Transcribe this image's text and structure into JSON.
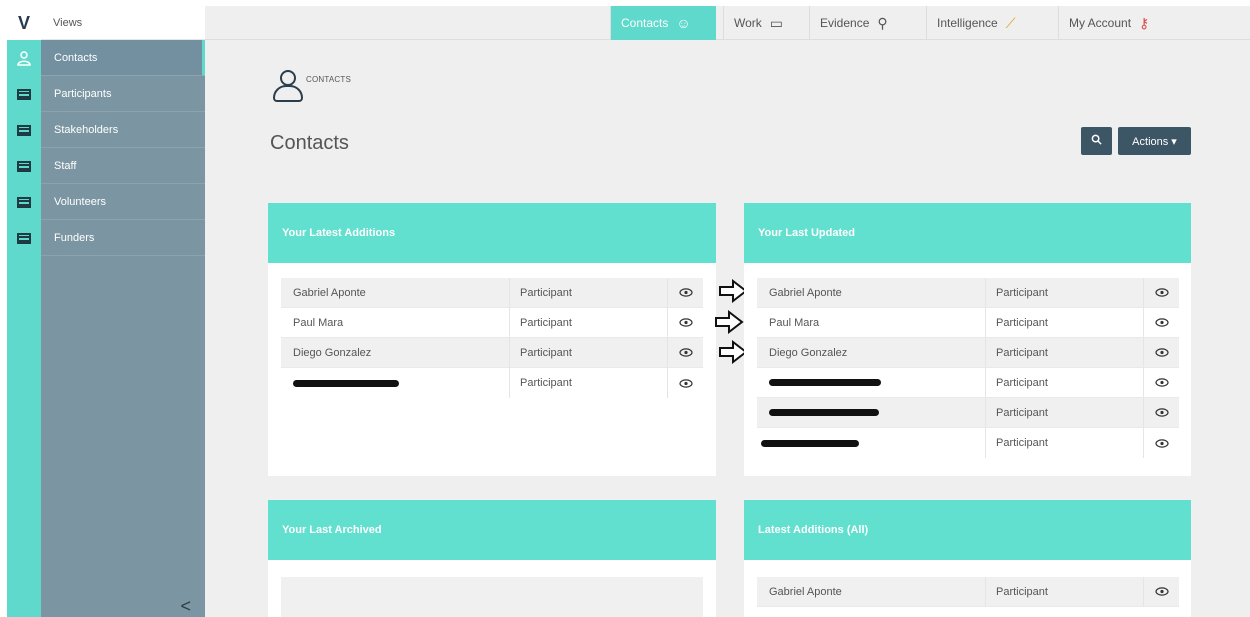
{
  "rail": {
    "logo": "V"
  },
  "sidebar": {
    "views_label": "Views",
    "items": [
      {
        "label": "Contacts",
        "icon": "person-icon",
        "active": true
      },
      {
        "label": "Participants",
        "icon": "list-icon"
      },
      {
        "label": "Stakeholders",
        "icon": "list-icon"
      },
      {
        "label": "Staff",
        "icon": "list-icon"
      },
      {
        "label": "Volunteers",
        "icon": "list-icon"
      },
      {
        "label": "Funders",
        "icon": "list-icon"
      }
    ],
    "collapse_glyph": "<"
  },
  "topnav": [
    {
      "label": "Contacts",
      "icon": "person-icon",
      "glyph": "☺",
      "active": true
    },
    {
      "label": "Work",
      "icon": "folder-icon",
      "glyph": "▭"
    },
    {
      "label": "Evidence",
      "icon": "magnifier-icon",
      "glyph": "⚲"
    },
    {
      "label": "Intelligence",
      "icon": "chart-line-icon",
      "glyph": "⟋"
    },
    {
      "label": "My Account",
      "icon": "key-icon",
      "glyph": "⚷"
    }
  ],
  "breadcrumb": {
    "text": "CONTACTS"
  },
  "page": {
    "title": "Contacts"
  },
  "toolbar": {
    "search_glyph": "🔍",
    "actions_label": "Actions ▾"
  },
  "panels": {
    "latest_additions": {
      "title": "Your Latest Additions",
      "rows": [
        {
          "name": "Gabriel Aponte",
          "type": "Participant"
        },
        {
          "name": "Paul Mara",
          "type": "Participant"
        },
        {
          "name": "Diego Gonzalez",
          "type": "Participant"
        },
        {
          "name": "",
          "type": "Participant",
          "redacted": true
        }
      ]
    },
    "last_updated": {
      "title": "Your Last Updated",
      "rows": [
        {
          "name": "Gabriel Aponte",
          "type": "Participant"
        },
        {
          "name": "Paul Mara",
          "type": "Participant"
        },
        {
          "name": "Diego Gonzalez",
          "type": "Participant"
        },
        {
          "name": "",
          "type": "Participant",
          "redacted": true
        },
        {
          "name": "",
          "type": "Participant",
          "redacted": true
        },
        {
          "name": "",
          "type": "Participant",
          "redacted": true
        }
      ]
    },
    "last_archived": {
      "title": "Your Last Archived"
    },
    "latest_additions_all": {
      "title": "Latest Additions (All)",
      "rows": [
        {
          "name": "Gabriel Aponte",
          "type": "Participant"
        }
      ]
    }
  },
  "eye_glyph": "👁",
  "colors": {
    "teal": "#61e0cf",
    "sidebar": "#7b96a2",
    "button": "#3d5666"
  }
}
